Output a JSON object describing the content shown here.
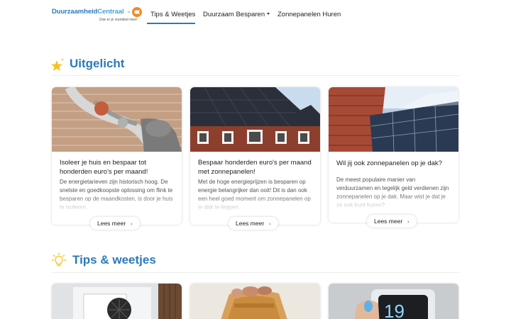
{
  "brand": {
    "name_part1": "Duurzaamheid",
    "name_part2": "Centraal",
    "tm": "nl",
    "tagline": "Doe er je voordeel mee!",
    "accent_color": "#2a7ab8",
    "badge_color": "#f08a24"
  },
  "nav": {
    "items": [
      {
        "label": "Tips & Weetjes",
        "active": true
      },
      {
        "label": "Duurzaam Besparen",
        "has_dropdown": true
      },
      {
        "label": "Zonnepanelen Huren"
      }
    ]
  },
  "featured": {
    "title": "Uitgelicht",
    "icon": "star-icon",
    "cards": [
      {
        "title": "Isoleer je huis en bespaar tot honderden euro's per maand!",
        "excerpt": "De energietarieven zijn historisch hoog. De snelste en goedkoopste oplossing om flink te besparen op de maandkosten, is door je huis te isoleren.",
        "button": "Lees meer",
        "image": "wall-insulation-photo"
      },
      {
        "title": "Bespaar honderden euro's per maand met zonnepanelen!",
        "excerpt": "Met de hoge energieprijzen is besparen op energie belangrijker dan ooit! Dit is dan ook een heel goed moment om zonnepanelen op je dak te leggen.",
        "button": "Lees meer",
        "image": "house-solar-roof-photo"
      },
      {
        "title": "Wil jij ook zonnepanelen op je dak?",
        "excerpt": "De meest populaire manier van verduurzamen en tegelijk geld verdienen zijn zonnepanelen op je dak. Maar wist je dat je ze ook kunt huren?",
        "button": "Lees meer",
        "image": "solar-panels-tiles-photo"
      }
    ]
  },
  "tips": {
    "title": "Tips & weetjes",
    "icon": "lightbulb-icon",
    "cards": [
      {
        "image": "heat-pump-photo"
      },
      {
        "image": "euro-banknotes-photo"
      },
      {
        "image": "thermostat-photo"
      }
    ]
  }
}
